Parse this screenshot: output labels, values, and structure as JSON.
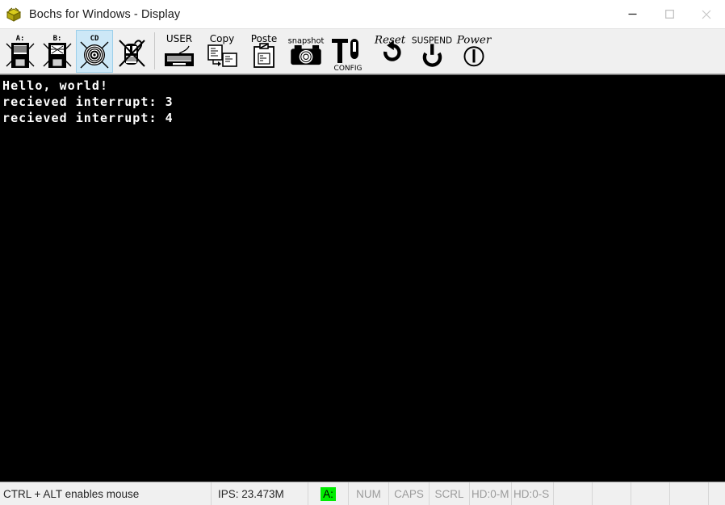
{
  "window": {
    "title": "Bochs for Windows - Display",
    "icon": "bochs-logo-icon",
    "controls": {
      "minimize_label": "Minimize",
      "maximize_label": "Maximize",
      "close_label": "Close"
    }
  },
  "toolbar": {
    "buttons": [
      {
        "id": "floppy-a",
        "label": "A:",
        "icon": "floppy-disk-a-icon",
        "selected": false
      },
      {
        "id": "floppy-b",
        "label": "B:",
        "icon": "floppy-disk-b-icon",
        "selected": false
      },
      {
        "id": "cdrom",
        "label": "CD",
        "icon": "cdrom-icon",
        "selected": true
      },
      {
        "id": "mouse",
        "label": "",
        "icon": "mouse-disabled-icon",
        "selected": false
      },
      {
        "id": "user",
        "label": "USER",
        "icon": "keyboard-user-icon",
        "selected": false
      },
      {
        "id": "copy",
        "label": "Copy",
        "icon": "copy-icon",
        "selected": false
      },
      {
        "id": "paste",
        "label": "Poste",
        "icon": "paste-clipboard-icon",
        "selected": false
      },
      {
        "id": "snapshot",
        "label": "snapshot",
        "icon": "camera-snapshot-icon",
        "selected": false
      },
      {
        "id": "config",
        "label": "CONFIG",
        "icon": "wrench-config-icon",
        "selected": false
      },
      {
        "id": "reset",
        "label": "Reset",
        "icon": "reset-arrow-icon",
        "selected": false
      },
      {
        "id": "suspend",
        "label": "SUSPEND",
        "icon": "suspend-icon",
        "selected": false
      },
      {
        "id": "power",
        "label": "Power",
        "icon": "power-icon",
        "selected": false
      }
    ]
  },
  "display": {
    "background_color": "#000000",
    "text_color": "#ffffff",
    "lines": [
      "Hello, world!",
      "recieved interrupt: 3",
      "recieved interrupt: 4"
    ]
  },
  "statusbar": {
    "message": "CTRL + ALT enables mouse",
    "ips": "IPS: 23.473M",
    "floppy_led": {
      "label": "A:",
      "active_color": "#00ec00",
      "text_color": "#000000"
    },
    "flags": [
      {
        "label": "NUM",
        "active": false
      },
      {
        "label": "CAPS",
        "active": false
      },
      {
        "label": "SCRL",
        "active": false
      }
    ],
    "disks": [
      {
        "label": "HD:0-M",
        "active": false
      },
      {
        "label": "HD:0-S",
        "active": false
      }
    ],
    "empty_cells": 5
  }
}
